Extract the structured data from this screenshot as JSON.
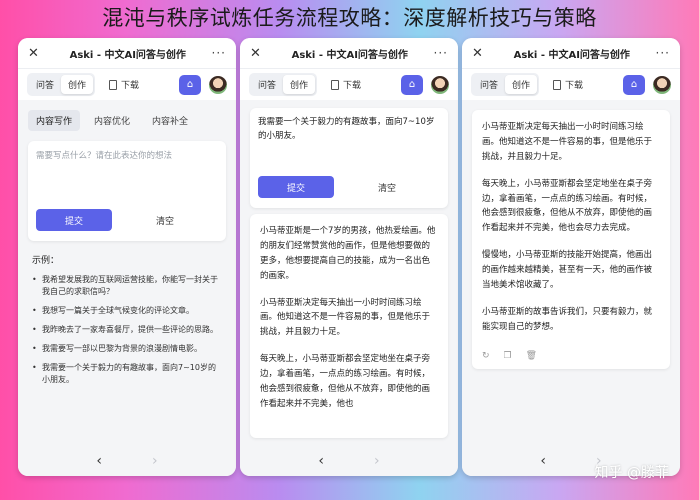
{
  "banner": "混沌与秩序试炼任务流程攻略：深度解析技巧与策略",
  "watermark": "知乎 @滕菲",
  "app": {
    "title": "Aski - 中文AI问答与创作",
    "more": "···",
    "close": "✕",
    "seg_qa": "问答",
    "seg_create": "创作",
    "download": "下载"
  },
  "panel1": {
    "tabs": [
      "内容写作",
      "内容优化",
      "内容补全"
    ],
    "placeholder": "需要写点什么？请在此表达你的想法",
    "submit": "提交",
    "clear": "清空",
    "examples_title": "示例：",
    "examples": [
      "我希望发展我的互联网运营技能，你能写一封关于我自己的求职信吗？",
      "我想写一篇关于全球气候变化的评论文章。",
      "我昨晚去了一家寿喜餐厅，提供一些评论的思路。",
      "我需要写一部以巴黎为背景的浪漫剧情电影。",
      "我需要一个关于毅力的有趣故事，面向7~10岁的小朋友。"
    ]
  },
  "panel2": {
    "question": "我需要一个关于毅力的有趣故事，面向7~10岁的小朋友。",
    "submit": "提交",
    "clear": "清空",
    "paragraphs": [
      "小马蒂亚斯是一个7岁的男孩，他热爱绘画。他的朋友们经常赞赏他的画作，但是他想要做的更多，他想要提高自己的技能，成为一名出色的画家。",
      "小马蒂亚斯决定每天抽出一小时时间练习绘画。他知道这不是一件容易的事，但是他乐于挑战，并且毅力十足。",
      "每天晚上，小马蒂亚斯都会坚定地坐在桌子旁边，拿着画笔，一点点的练习绘画。有时候，他会感到很疲惫，但他从不放弃，即使他的画作看起来并不完美，他也"
    ]
  },
  "panel3": {
    "paragraphs": [
      "小马蒂亚斯决定每天抽出一小时时间练习绘画。他知道这不是一件容易的事，但是他乐于挑战，并且毅力十足。",
      "每天晚上，小马蒂亚斯都会坚定地坐在桌子旁边，拿着画笔，一点点的练习绘画。有时候，他会感到很疲惫，但他从不放弃，即使他的画作看起来并不完美，他也会尽力去完成。",
      "慢慢地，小马蒂亚斯的技能开始提高，他画出的画作越来越精美，甚至有一天，他的画作被当地美术馆收藏了。",
      "小马蒂亚斯的故事告诉我们，只要有毅力，就能实现自己的梦想。"
    ],
    "action_icons": [
      "refresh-icon",
      "copy-icon",
      "delete-icon"
    ]
  },
  "nav": {
    "back": "‹",
    "forward": "›"
  }
}
